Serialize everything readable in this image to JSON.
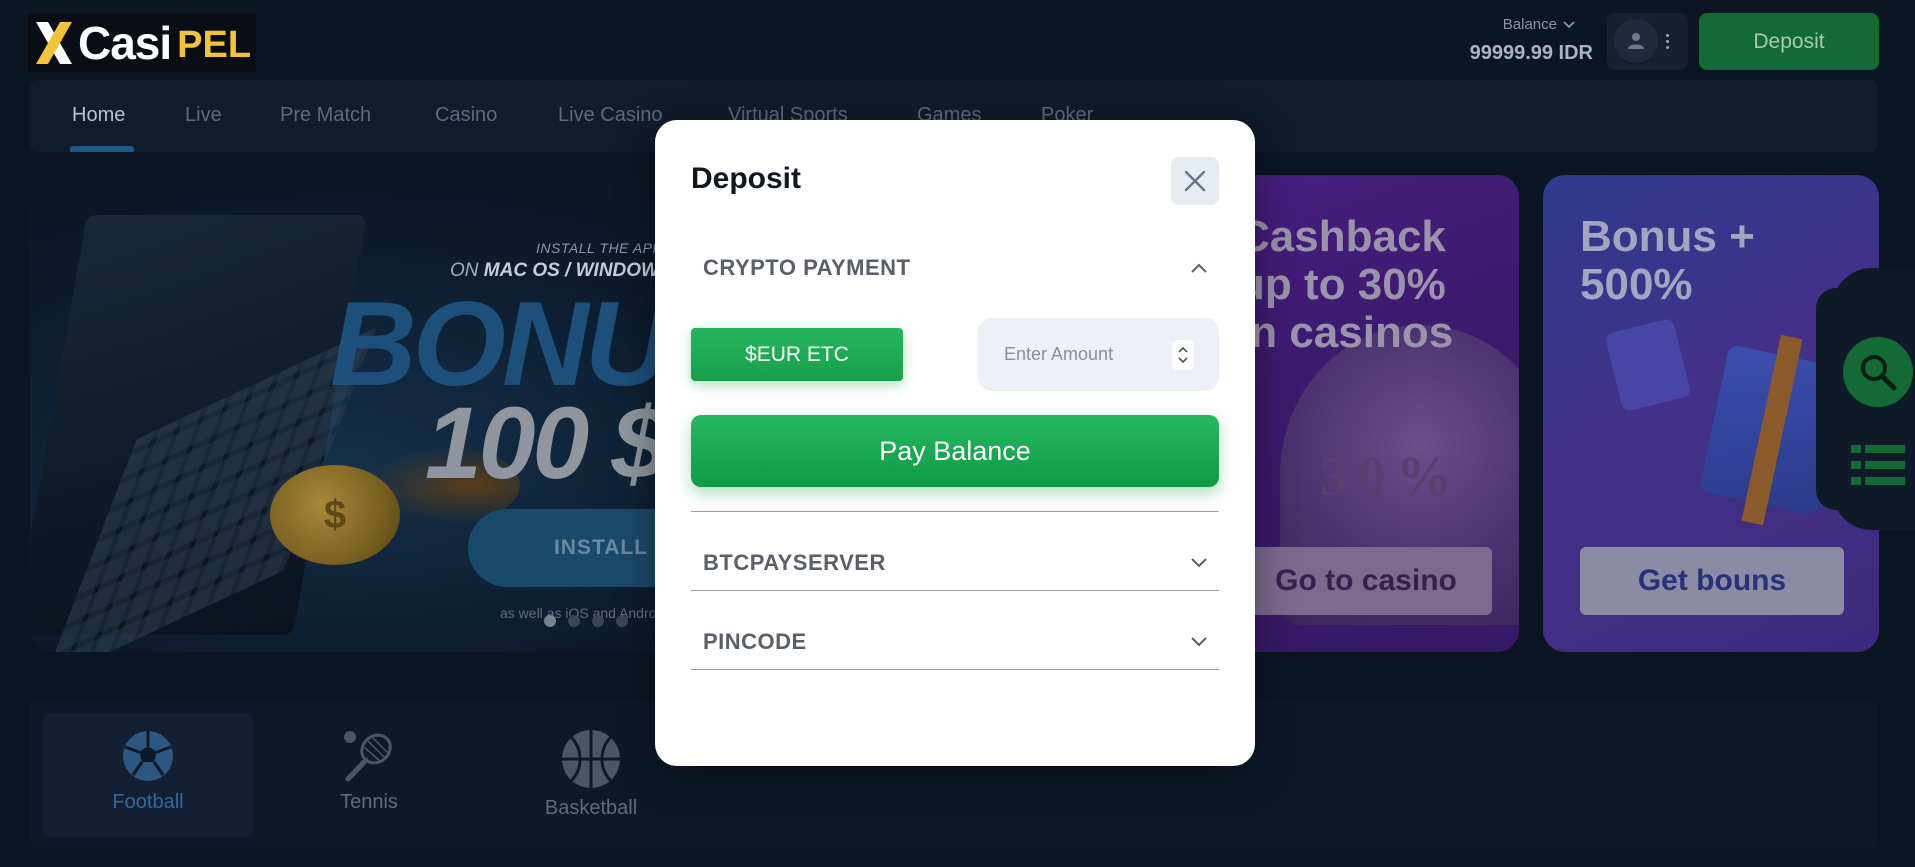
{
  "brand": {
    "logo_word1": "Casi",
    "logo_word2": "PEL"
  },
  "header": {
    "balance_label": "Balance",
    "balance_value": "99999.99 IDR",
    "deposit_label": "Deposit"
  },
  "nav": {
    "items": [
      {
        "label": "Home"
      },
      {
        "label": "Live"
      },
      {
        "label": "Pre Match"
      },
      {
        "label": "Casino"
      },
      {
        "label": "Live Casino"
      },
      {
        "label": "Virtual Sports"
      },
      {
        "label": "Games"
      },
      {
        "label": "Poker"
      }
    ]
  },
  "banners": {
    "app": {
      "tag_line1": "INSTALL THE APP",
      "tag_line2_prefix": "ON ",
      "tag_line2_strong": "MAC OS / WINDOWS",
      "headline": "BONUS",
      "amount": "100 $",
      "button": "INSTALL",
      "footnote": "as well as iOS and Android"
    },
    "cashback": {
      "line1": "Cashback",
      "line2": "up to 30%",
      "line3": "in casinos",
      "button": "Go to casino"
    },
    "bonus": {
      "line1": "Bonus +",
      "line2": "500%",
      "button": "Get bouns"
    }
  },
  "sports": [
    {
      "label": "Football",
      "icon": "football-icon"
    },
    {
      "label": "Tennis",
      "icon": "tennis-icon"
    },
    {
      "label": "Basketball",
      "icon": "basketball-icon"
    }
  ],
  "modal": {
    "title": "Deposit",
    "sections": [
      {
        "title": "CRYPTO PAYMENT",
        "expanded": true
      },
      {
        "title": "BTCPAYSERVER",
        "expanded": false
      },
      {
        "title": "PINCODE",
        "expanded": false
      }
    ],
    "method_label": "$EUR ETC",
    "amount_placeholder": "Enter Amount",
    "pay_label": "Pay Balance"
  },
  "colors": {
    "accent_green": "#18a04c",
    "page_bg": "#0b1524",
    "logo_gold": "#f2c43a"
  }
}
